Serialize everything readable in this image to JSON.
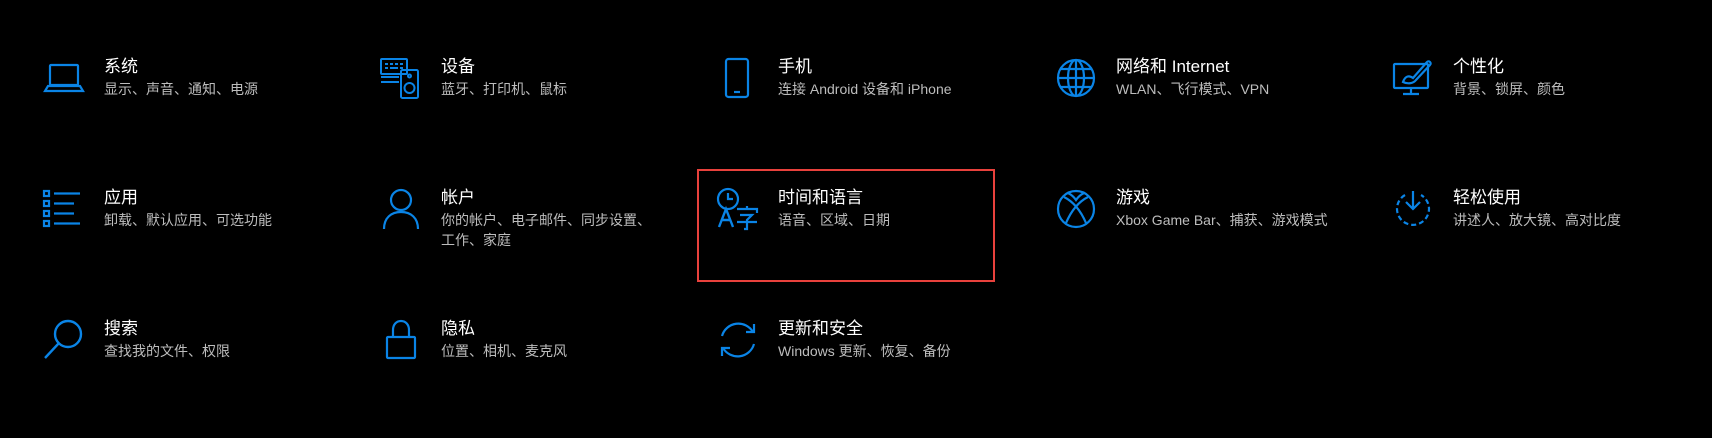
{
  "accent_color": "#0a84e6",
  "selection_color": "#e8413c",
  "tiles": [
    {
      "title": "系统",
      "desc": "显示、声音、通知、电源",
      "icon": "laptop-icon"
    },
    {
      "title": "设备",
      "desc": "蓝牙、打印机、鼠标",
      "icon": "devices-icon"
    },
    {
      "title": "手机",
      "desc": "连接 Android 设备和 iPhone",
      "icon": "phone-icon"
    },
    {
      "title": "网络和 Internet",
      "desc": "WLAN、飞行模式、VPN",
      "icon": "globe-icon"
    },
    {
      "title": "个性化",
      "desc": "背景、锁屏、颜色",
      "icon": "personalization-icon"
    },
    {
      "title": "应用",
      "desc": "卸载、默认应用、可选功能",
      "icon": "apps-list-icon"
    },
    {
      "title": "帐户",
      "desc": "你的帐户、电子邮件、同步设置、工作、家庭",
      "icon": "person-icon"
    },
    {
      "title": "时间和语言",
      "desc": "语音、区域、日期",
      "icon": "time-language-icon",
      "selected": true
    },
    {
      "title": "游戏",
      "desc": "Xbox Game Bar、捕获、游戏模式",
      "icon": "xbox-icon"
    },
    {
      "title": "轻松使用",
      "desc": "讲述人、放大镜、高对比度",
      "icon": "ease-of-access-icon"
    },
    {
      "title": "搜索",
      "desc": "查找我的文件、权限",
      "icon": "search-icon"
    },
    {
      "title": "隐私",
      "desc": "位置、相机、麦克风",
      "icon": "lock-icon"
    },
    {
      "title": "更新和安全",
      "desc": "Windows 更新、恢复、备份",
      "icon": "sync-icon"
    }
  ]
}
